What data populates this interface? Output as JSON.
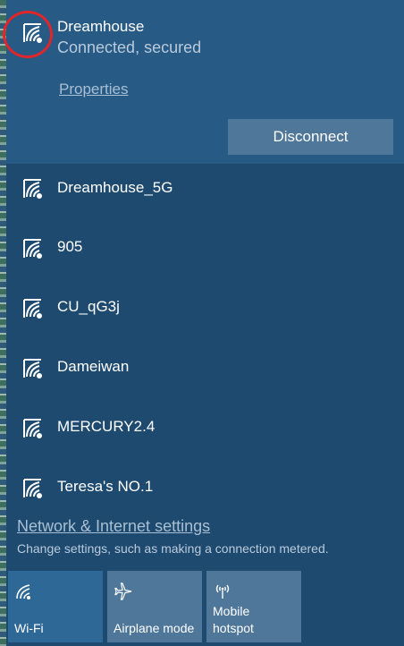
{
  "connected_network": {
    "name": "Dreamhouse",
    "status": "Connected, secured",
    "properties_label": "Properties",
    "disconnect_label": "Disconnect",
    "icon": "wifi-secured-icon"
  },
  "networks": [
    {
      "name": "Dreamhouse_5G",
      "icon": "wifi-secured-icon"
    },
    {
      "name": "905",
      "icon": "wifi-secured-icon"
    },
    {
      "name": "CU_qG3j",
      "icon": "wifi-secured-icon"
    },
    {
      "name": "Dameiwan",
      "icon": "wifi-secured-icon"
    },
    {
      "name": "MERCURY2.4",
      "icon": "wifi-secured-icon"
    },
    {
      "name": "Teresa's NO.1",
      "icon": "wifi-secured-icon"
    }
  ],
  "settings": {
    "link_label": "Network & Internet settings",
    "hint": "Change settings, such as making a connection metered."
  },
  "quick_actions": [
    {
      "label": "Wi-Fi",
      "icon": "wifi-icon",
      "active": true
    },
    {
      "label": "Airplane mode",
      "icon": "airplane-icon",
      "active": false
    },
    {
      "label": "Mobile hotspot",
      "icon": "hotspot-icon",
      "active": false
    }
  ],
  "colors": {
    "panel": "#1e4a70",
    "connected_panel": "#275a85",
    "tile_active": "#2e6896",
    "tile_inactive": "#4f7799",
    "highlight": "#e0262b"
  }
}
